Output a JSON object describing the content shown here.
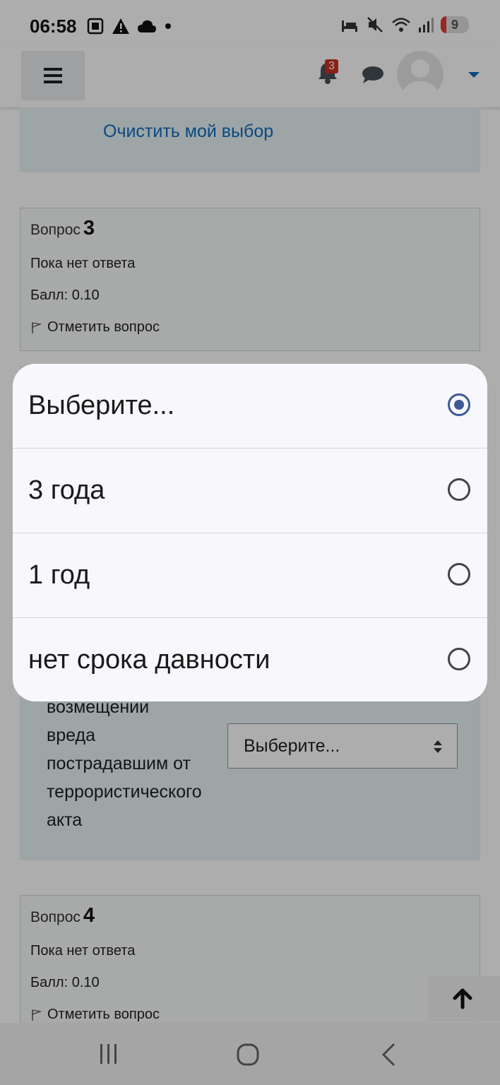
{
  "status_bar": {
    "time": "06:58",
    "battery": "9"
  },
  "navbar": {
    "notification_count": "3"
  },
  "question3": {
    "label": "Вопрос",
    "number": "3",
    "state": "Пока нет ответа",
    "grade": "Балл: 0.10",
    "flag_label": "Отметить вопрос"
  },
  "clear_choice": "Очистить мой выбор",
  "answer": {
    "prompt_lines": [
      "возмещении",
      "вреда",
      "пострадавшим от",
      "террористического",
      "акта"
    ],
    "select_value": "Выберите..."
  },
  "question4": {
    "label": "Вопрос",
    "number": "4",
    "state": "Пока нет ответа",
    "grade": "Балл: 0.10",
    "flag_label": "Отметить вопрос"
  },
  "dropdown": {
    "options": [
      {
        "label": "Выберите...",
        "selected": true
      },
      {
        "label": "3 года",
        "selected": false
      },
      {
        "label": "1 год",
        "selected": false
      },
      {
        "label": "нет срока давности",
        "selected": false
      }
    ]
  },
  "colors": {
    "link": "#0f6cbf",
    "radio_selected": "#3d5a93",
    "badge": "#ca3120",
    "answer_bg": "#e7f3f5"
  }
}
